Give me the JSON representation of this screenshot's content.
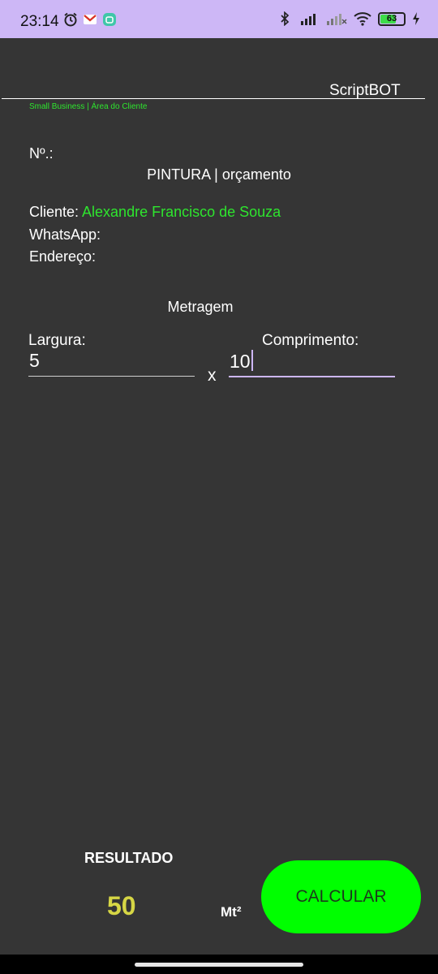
{
  "status_bar": {
    "time": "23:14",
    "battery_level": "63",
    "left_icons": [
      "alarm-icon",
      "gmail-icon",
      "app-notification-icon"
    ],
    "right_icons": [
      "bluetooth-icon",
      "signal-icon",
      "signal-weak-icon",
      "wifi-icon",
      "battery-icon",
      "charging-icon"
    ],
    "accent": "#cdb7f6"
  },
  "header": {
    "brand": "ScriptBOT",
    "subtitle": "Small Business | Área do Cliente"
  },
  "document": {
    "number_label": "Nº.:",
    "title": "PINTURA | orçamento"
  },
  "client": {
    "name_label": "Cliente:",
    "name_value": "Alexandre Francisco de Souza",
    "whatsapp_label": "WhatsApp:",
    "address_label": "Endereço:"
  },
  "measure": {
    "section_title": "Metragem",
    "width_label": "Largura:",
    "width_value": "5",
    "times_symbol": "x",
    "length_label": "Comprimento:",
    "length_value": "10"
  },
  "result": {
    "label": "RESULTADO",
    "value": "50",
    "unit": "Mt²"
  },
  "actions": {
    "calculate_label": "CALCULAR"
  },
  "colors": {
    "background": "#353535",
    "highlight_green": "#2ee52e",
    "button_green": "#00ff00",
    "result_yellow": "#d6d645"
  }
}
